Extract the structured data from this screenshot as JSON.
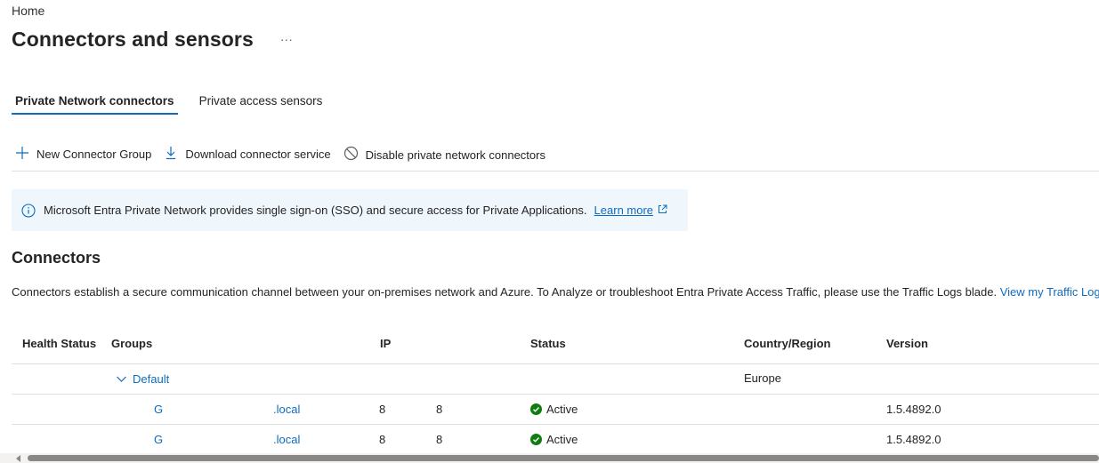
{
  "breadcrumb": {
    "home": "Home"
  },
  "page": {
    "title": "Connectors and sensors",
    "more": "···"
  },
  "tabs": [
    {
      "label": "Private Network connectors"
    },
    {
      "label": "Private access sensors"
    }
  ],
  "toolbar": {
    "new_group": "New Connector Group",
    "download": "Download connector service",
    "disable": "Disable private network connectors"
  },
  "banner": {
    "text": "Microsoft Entra Private Network provides single sign-on (SSO) and secure access for Private Applications.",
    "link": "Learn more"
  },
  "connectors": {
    "title": "Connectors",
    "description": "Connectors establish a secure communication channel between your on-premises network and Azure. To Analyze or troubleshoot Entra Private Access Traffic, please use the Traffic Logs blade.",
    "link": "View my Traffic Logs"
  },
  "table": {
    "headers": {
      "health": "Health Status",
      "groups": "Groups",
      "ip": "IP",
      "status": "Status",
      "country": "Country/Region",
      "version": "Version"
    },
    "group": {
      "name": "Default",
      "region": "Europe"
    },
    "rows": [
      {
        "name_prefix": "G",
        "name_suffix": ".local",
        "ip_a": "8",
        "ip_b": "8",
        "status": "Active",
        "version": "1.5.4892.0"
      },
      {
        "name_prefix": "G",
        "name_suffix": ".local",
        "ip_a": "8",
        "ip_b": "8",
        "status": "Active",
        "version": "1.5.4892.0"
      }
    ]
  },
  "colors": {
    "accent": "#0f6cbd",
    "active": "#107c10",
    "banner_bg": "#eff6fc"
  }
}
